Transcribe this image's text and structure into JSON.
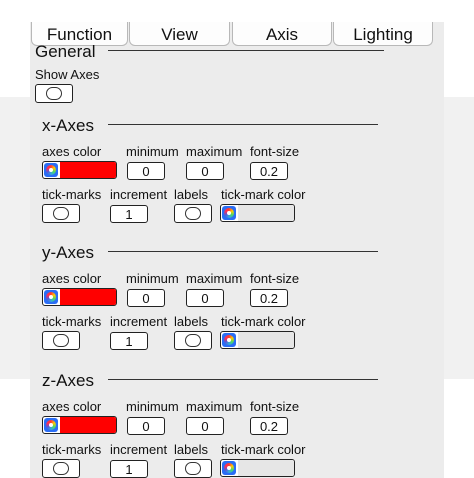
{
  "tabs": [
    "Function",
    "View",
    "Axis",
    "Lighting"
  ],
  "general": {
    "heading": "General",
    "show_axes_label": "Show Axes"
  },
  "field_labels": {
    "axes_color": "axes color",
    "minimum": "minimum",
    "maximum": "maximum",
    "font_size": "font-size",
    "tick_marks": "tick-marks",
    "increment": "increment",
    "labels": "labels",
    "tick_mark_color": "tick-mark color"
  },
  "axes": [
    {
      "heading": "x-Axes",
      "minimum": "0",
      "maximum": "0",
      "font_size": "0.2",
      "increment": "1",
      "axes_color": "#ff0000",
      "tick_mark_color": "#e6e6e6"
    },
    {
      "heading": "y-Axes",
      "minimum": "0",
      "maximum": "0",
      "font_size": "0.2",
      "increment": "1",
      "axes_color": "#ff0000",
      "tick_mark_color": "#e6e6e6"
    },
    {
      "heading": "z-Axes",
      "minimum": "0",
      "maximum": "0",
      "font_size": "0.2",
      "increment": "1",
      "axes_color": "#ff0000",
      "tick_mark_color": "#e6e6e6"
    }
  ]
}
